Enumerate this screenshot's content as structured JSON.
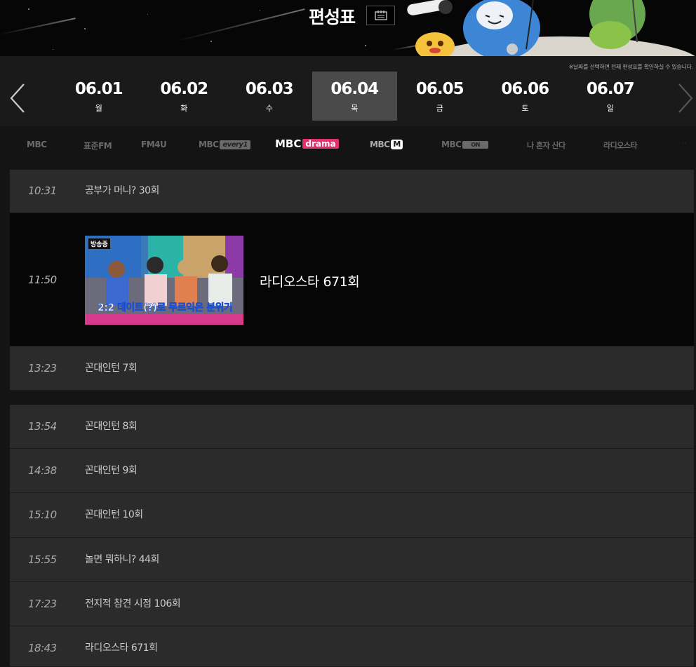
{
  "header": {
    "title": "편성표",
    "calendar_icon": "calendar-icon"
  },
  "date_nav": {
    "note": "※날짜를 선택하면 전체 편성표를 확인하실 수 있습니다.",
    "prev_icon": "chevron-left-icon",
    "next_icon": "chevron-right-icon",
    "dates": [
      {
        "date": "06.01",
        "day": "월"
      },
      {
        "date": "06.02",
        "day": "화"
      },
      {
        "date": "06.03",
        "day": "수"
      },
      {
        "date": "06.04",
        "day": "목",
        "active": true
      },
      {
        "date": "06.05",
        "day": "금"
      },
      {
        "date": "06.06",
        "day": "토"
      },
      {
        "date": "06.07",
        "day": "일"
      }
    ]
  },
  "channels": {
    "mbc": "MBC",
    "standard_fm": "표준FM",
    "fm4u": "FM4U",
    "every1_main": "MBC",
    "every1_badge": "every1",
    "drama_main": "MBC",
    "drama_badge": "drama",
    "m_main": "MBC",
    "m_badge": "M",
    "on_main": "MBC",
    "on_badge": "ON",
    "alone": "나 혼자 산다",
    "radiostar": "라디오스타"
  },
  "onair": {
    "live_badge": "방송중",
    "caption": "2:2 데이트(?)로 무르익은 분위기"
  },
  "schedule": [
    {
      "time": "10:31",
      "title": "공부가 머니? 30회"
    },
    {
      "time": "11:50",
      "title": "라디오스타 671회"
    },
    {
      "time": "13:23",
      "title": "꼰대인턴 7회"
    },
    {
      "time": "13:54",
      "title": "꼰대인턴 8회"
    },
    {
      "time": "14:38",
      "title": "꼰대인턴 9회"
    },
    {
      "time": "15:10",
      "title": "꼰대인턴 10회"
    },
    {
      "time": "15:55",
      "title": "놀면 뭐하니? 44회"
    },
    {
      "time": "17:23",
      "title": "전지적 참견 시점 106회"
    },
    {
      "time": "18:43",
      "title": "라디오스타 671회"
    }
  ],
  "colors": {
    "accent_drama": "#e3306f",
    "active_date_bg": "#4a4a4a",
    "row_bg": "#2b2b2b",
    "onair_bg": "#060606"
  }
}
